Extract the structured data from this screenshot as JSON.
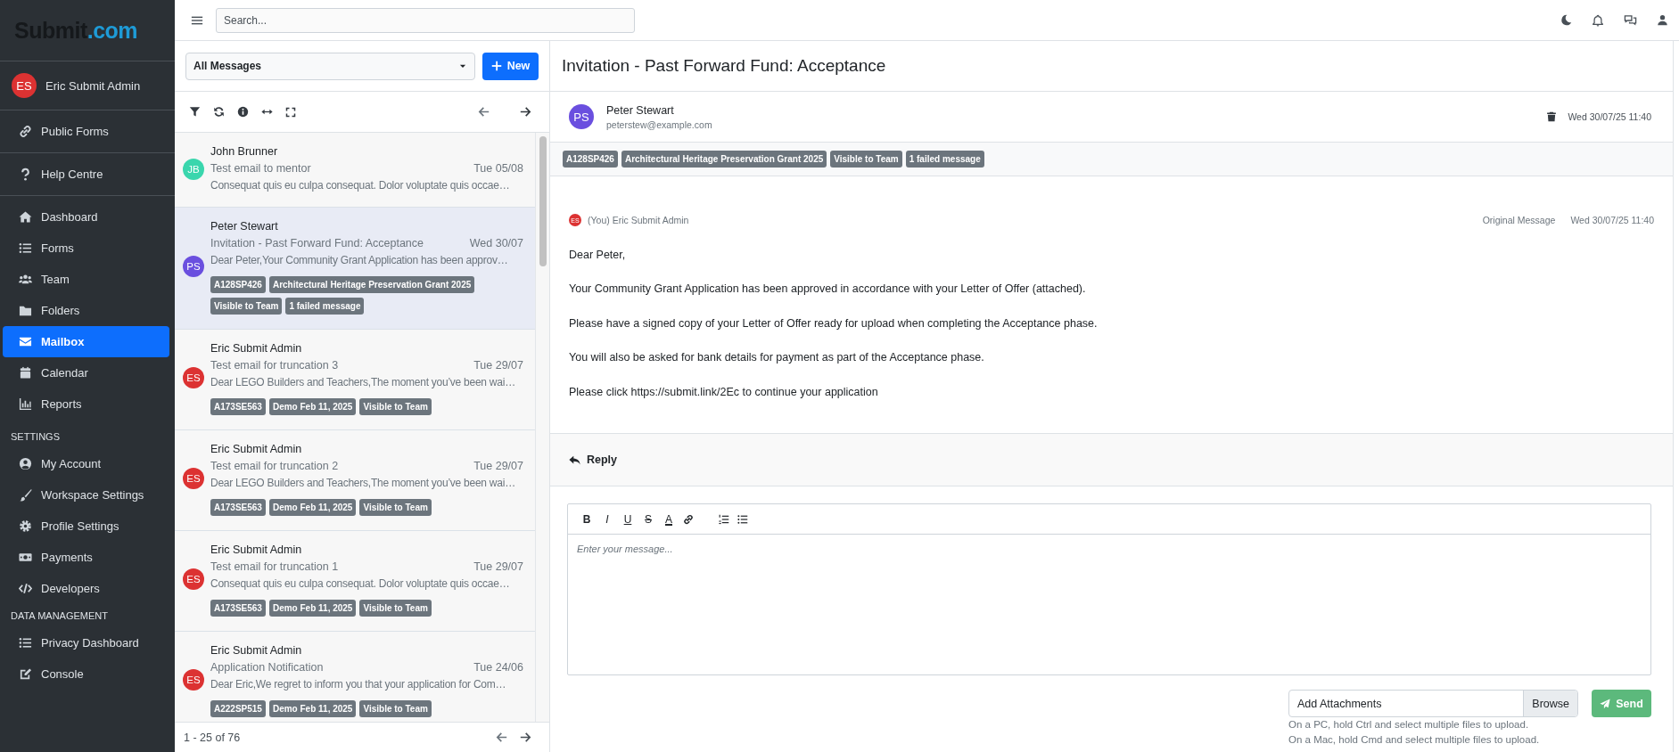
{
  "logo": {
    "name": "Submit",
    "accent": ".com"
  },
  "sidebar": {
    "user": {
      "initials": "ES",
      "name": "Eric Submit Admin",
      "color": "#dc3232"
    },
    "groups": [
      {
        "items": [
          {
            "label": "Public Forms",
            "selected": false
          }
        ]
      },
      {
        "items": [
          {
            "label": "Help Centre",
            "selected": false
          }
        ]
      },
      {
        "items": [
          {
            "label": "Dashboard",
            "selected": false
          },
          {
            "label": "Forms",
            "selected": false
          },
          {
            "label": "Team",
            "selected": false
          },
          {
            "label": "Folders",
            "selected": false
          },
          {
            "label": "Mailbox",
            "selected": true
          },
          {
            "label": "Calendar",
            "selected": false
          },
          {
            "label": "Reports",
            "selected": false
          }
        ]
      },
      {
        "heading": "SETTINGS",
        "items": [
          {
            "label": "My Account",
            "selected": false
          },
          {
            "label": "Workspace Settings",
            "selected": false
          },
          {
            "label": "Profile Settings",
            "selected": false
          },
          {
            "label": "Payments",
            "selected": false
          },
          {
            "label": "Developers",
            "selected": false
          }
        ]
      },
      {
        "heading": "DATA MANAGEMENT",
        "items": [
          {
            "label": "Privacy Dashboard",
            "selected": false
          },
          {
            "label": "Console",
            "selected": false
          }
        ]
      }
    ]
  },
  "topbar": {
    "search": {
      "placeholder": "Search..."
    }
  },
  "messages": {
    "filter": "All Messages",
    "new_button": "New",
    "pagination": "1 - 25 of 76",
    "items": [
      {
        "initials": "JB",
        "color": "#3ad6ad",
        "sender": "John Brunner",
        "subject": "Test email to mentor",
        "date": "Tue 05/08",
        "preview": "Consequat quis eu culpa consequat. Dolor voluptate quis occae…",
        "selected": false
      },
      {
        "initials": "PS",
        "color": "#6a4fdf",
        "sender": "Peter Stewart",
        "subject": "Invitation - Past Forward Fund: Acceptance",
        "date": "Wed 30/07",
        "preview": "Dear Peter,Your Community Grant Application has been approv…",
        "tags": [
          "A128SP426",
          "Architectural Heritage Preservation Grant 2025",
          "Visible to Team",
          "1 failed message"
        ],
        "selected": true
      },
      {
        "initials": "ES",
        "color": "#dc3232",
        "sender": "Eric Submit Admin",
        "subject": "Test email for truncation 3",
        "date": "Tue 29/07",
        "preview": "Dear LEGO Builders and Teachers,The moment you’ve been wai…",
        "tags": [
          "A173SE563",
          "Demo Feb 11, 2025",
          "Visible to Team"
        ],
        "selected": false
      },
      {
        "initials": "ES",
        "color": "#dc3232",
        "sender": "Eric Submit Admin",
        "subject": "Test email for truncation 2",
        "date": "Tue 29/07",
        "preview": "Dear LEGO Builders and Teachers,The moment you’ve been wai…",
        "tags": [
          "A173SE563",
          "Demo Feb 11, 2025",
          "Visible to Team"
        ],
        "selected": false
      },
      {
        "initials": "ES",
        "color": "#dc3232",
        "sender": "Eric Submit Admin",
        "subject": "Test email for truncation 1",
        "date": "Tue 29/07",
        "preview": "Consequat quis eu culpa consequat. Dolor voluptate quis occae…",
        "tags": [
          "A173SE563",
          "Demo Feb 11, 2025",
          "Visible to Team"
        ],
        "selected": false
      },
      {
        "initials": "ES",
        "color": "#dc3232",
        "sender": "Eric Submit Admin",
        "subject": "Application Notification",
        "date": "Tue 24/06",
        "preview": "Dear Eric,We regret to inform you that your application for Com…",
        "tags": [
          "A222SP515",
          "Demo Feb 11, 2025",
          "Visible to Team"
        ],
        "selected": false
      }
    ]
  },
  "view": {
    "title": "Invitation - Past Forward Fund: Acceptance",
    "sender": {
      "initials": "PS",
      "color": "#6a4fdf",
      "name": "Peter Stewart",
      "email": "peterstew@example.com",
      "date": "Wed 30/07/25 11:40"
    },
    "tags": [
      "A128SP426",
      "Architectural Heritage Preservation Grant 2025",
      "Visible to Team",
      "1 failed message"
    ],
    "message": {
      "initials": "ES",
      "color": "#dc3232",
      "author": "(You) Eric Submit Admin",
      "label": "Original Message",
      "date": "Wed 30/07/25 11:40",
      "paragraphs": [
        "Dear Peter,",
        "Your Community Grant Application has been approved in accordance with your Letter of Offer (attached).",
        "Please have a signed copy of your Letter of Offer ready for upload when completing the Acceptance phase.",
        "You will also be asked for bank details for payment as part of the Acceptance phase.",
        "Please click https://submit.link/2Ec to continue your application"
      ]
    },
    "reply": "Reply",
    "editor": {
      "format_buttons": [
        {
          "kind": "bold",
          "text": "B"
        },
        {
          "kind": "italic",
          "text": "I"
        },
        {
          "kind": "underline",
          "text": "U"
        },
        {
          "kind": "strike",
          "text": "S"
        },
        {
          "kind": "color",
          "text": "A"
        }
      ],
      "placeholder": "Enter your message..."
    },
    "attachments": {
      "label": "Add Attachments",
      "browse": "Browse",
      "hints": [
        "On a PC, hold Ctrl and select multiple files to upload.",
        "On a Mac, hold Cmd and select multiple files to upload."
      ]
    },
    "send": "Send"
  }
}
